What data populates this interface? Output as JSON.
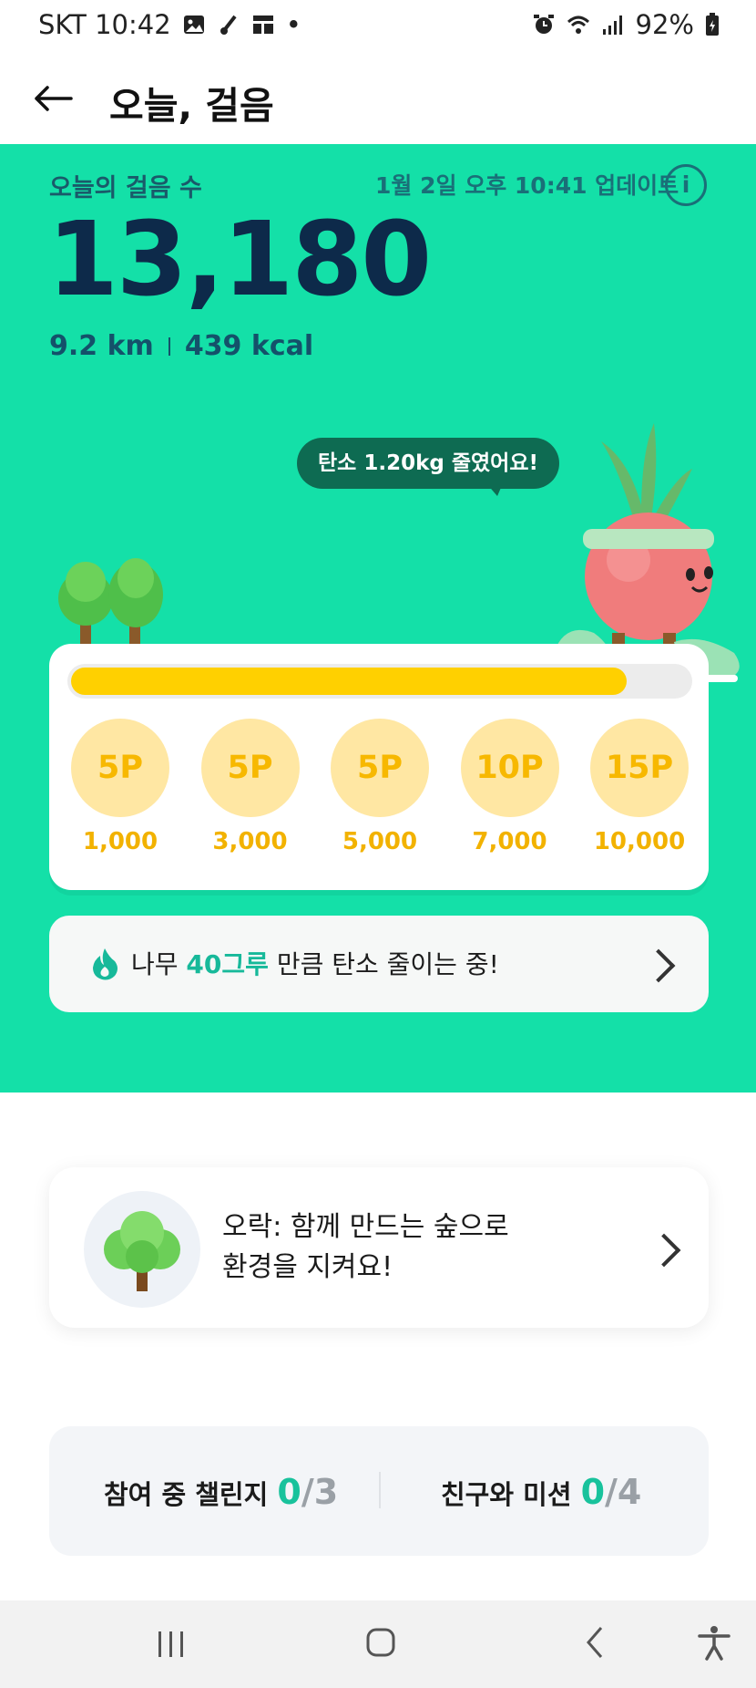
{
  "status_bar": {
    "carrier_time": "SKT 10:42",
    "dot": "•",
    "battery": "92%"
  },
  "header": {
    "title": "오늘, 걸음"
  },
  "hero": {
    "steps_label": "오늘의 걸음 수",
    "update_text": "1월 2일 오후 10:41 업데이트",
    "info_icon_glyph": "i",
    "step_count": "13,180",
    "distance": "9.2 km",
    "calories": "439 kcal",
    "bubble": "탄소 1.20kg 줄였어요!",
    "progress_fraction": 0.9,
    "rewards": [
      {
        "points": "5P",
        "steps": "1,000"
      },
      {
        "points": "5P",
        "steps": "3,000"
      },
      {
        "points": "5P",
        "steps": "5,000"
      },
      {
        "points": "10P",
        "steps": "7,000"
      },
      {
        "points": "15P",
        "steps": "10,000"
      }
    ],
    "carbon_prefix": "나무 ",
    "carbon_highlight": "40그루",
    "carbon_suffix": " 만큼 탄소 줄이는 중!",
    "colors": {
      "background": "#14e0a8",
      "progress": "#ffd000",
      "reward": "#ffe7a3",
      "highlight": "#17b99a"
    }
  },
  "forest_card": {
    "line1": "오락: 함께 만드는 숲으로",
    "line2": "환경을 지켜요!"
  },
  "challenges": {
    "participating_label": "참여 중 챌린지 ",
    "participating_value": "0",
    "participating_total": "/3",
    "friends_label": "친구와 미션 ",
    "friends_value": "0",
    "friends_total": "/4"
  },
  "icons": [
    "back-arrow-icon",
    "info-icon",
    "fire-icon",
    "chevron-right-icon",
    "tree-icon",
    "recent-apps-icon",
    "home-icon",
    "back-icon",
    "accessibility-icon"
  ]
}
